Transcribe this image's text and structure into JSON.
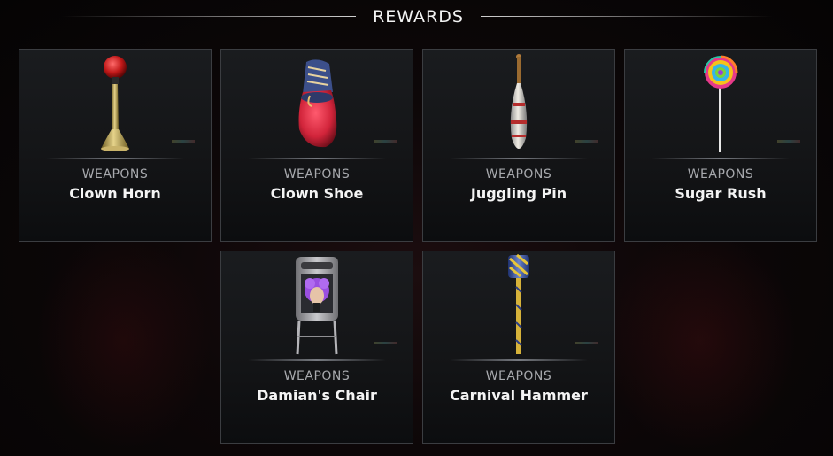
{
  "header": {
    "title": "REWARDS"
  },
  "rewards": [
    {
      "category": "WEAPONS",
      "name": "Clown Horn",
      "icon": "clown-horn-icon"
    },
    {
      "category": "WEAPONS",
      "name": "Clown Shoe",
      "icon": "clown-shoe-icon"
    },
    {
      "category": "WEAPONS",
      "name": "Juggling Pin",
      "icon": "juggling-pin-icon"
    },
    {
      "category": "WEAPONS",
      "name": "Sugar Rush",
      "icon": "lollipop-icon"
    },
    {
      "category": "WEAPONS",
      "name": "Damian's Chair",
      "icon": "folding-chair-icon"
    },
    {
      "category": "WEAPONS",
      "name": "Carnival Hammer",
      "icon": "carnival-hammer-icon"
    }
  ]
}
